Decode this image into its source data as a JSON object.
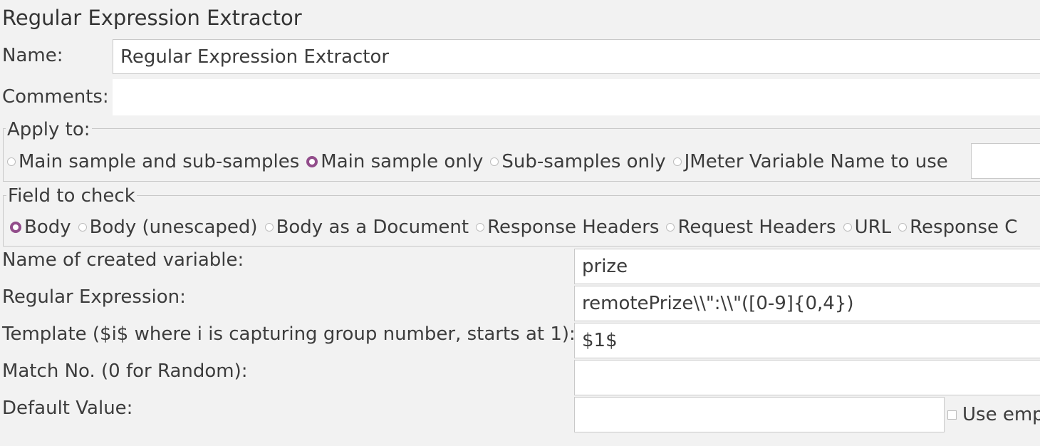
{
  "panel": {
    "title": "Regular Expression Extractor"
  },
  "name": {
    "label": "Name:",
    "value": "Regular Expression Extractor"
  },
  "comments": {
    "label": "Comments:",
    "value": ""
  },
  "apply_to": {
    "legend": "Apply to:",
    "options": [
      {
        "label": "Main sample and sub-samples",
        "selected": false
      },
      {
        "label": "Main sample only",
        "selected": true
      },
      {
        "label": "Sub-samples only",
        "selected": false
      },
      {
        "label": "JMeter Variable Name to use",
        "selected": false
      }
    ],
    "variable_value": ""
  },
  "field_to_check": {
    "legend": "Field to check",
    "options": [
      {
        "label": "Body",
        "selected": true
      },
      {
        "label": "Body (unescaped)",
        "selected": false
      },
      {
        "label": "Body as a Document",
        "selected": false
      },
      {
        "label": "Response Headers",
        "selected": false
      },
      {
        "label": "Request Headers",
        "selected": false
      },
      {
        "label": "URL",
        "selected": false
      },
      {
        "label": "Response C",
        "selected": false
      }
    ]
  },
  "params": {
    "variable_name": {
      "label": "Name of created variable:",
      "value": "prize"
    },
    "regex": {
      "label": "Regular Expression:",
      "value": "remotePrize\\\\\":\\\\\"([0-9]{0,4})"
    },
    "template": {
      "label": "Template ($i$ where i is capturing group number, starts at 1):",
      "value": "$1$"
    },
    "match_no": {
      "label": "Match No. (0 for Random):",
      "value": ""
    },
    "default_value": {
      "label": "Default Value:",
      "value": ""
    },
    "use_empty_label": "Use emp"
  },
  "colors": {
    "accent": "#924d8b",
    "background": "#f2f2f2"
  }
}
